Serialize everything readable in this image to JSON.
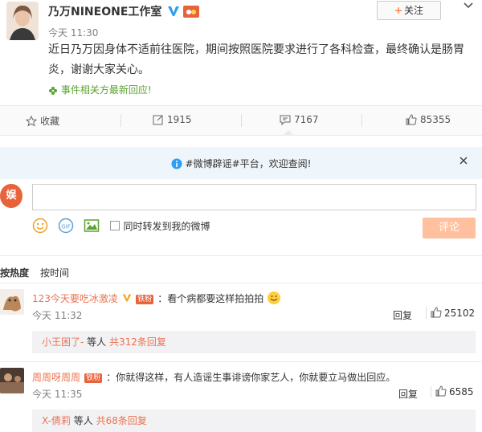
{
  "post": {
    "author": "乃万NINEONE工作室",
    "follow_label": "关注",
    "time": "今天 11:30",
    "content": "近日乃万因身体不适前往医院，期间按照医院要求进行了各科检查，最终确认是肠胃炎，谢谢大家关心。",
    "related_link": "事件相关方最新回应!"
  },
  "actions": {
    "favorite_label": "收藏",
    "repost_count": "1915",
    "comment_count": "7167",
    "like_count": "85355"
  },
  "notice": {
    "text": "#微博辟谣#平台，欢迎查阅!"
  },
  "composer": {
    "avatar_text": "娱",
    "repost_label": "同时转发到我的微博",
    "submit_label": "评论"
  },
  "sort": {
    "hot_label": "按热度",
    "time_label": "按时间"
  },
  "comments": [
    {
      "name": "123今天要吃冰激凌",
      "badge": "铁粉",
      "text": "：看个病都要这样拍拍拍",
      "time": "今天 11:32",
      "reply_label": "回复",
      "likes": "25102",
      "sub_user": "小王困了-",
      "sub_mid": " 等人 ",
      "sub_count": "共312条回复"
    },
    {
      "name": "周周呀周周",
      "badge": "铁粉",
      "text": "：你就得这样，有人造谣生事诽谤你家艺人，你就要立马做出回应。",
      "time": "今天 11:35",
      "reply_label": "回复",
      "likes": "6585",
      "sub_user": "X-倩莉",
      "sub_mid": " 等人 ",
      "sub_count": "共68条回复"
    }
  ]
}
